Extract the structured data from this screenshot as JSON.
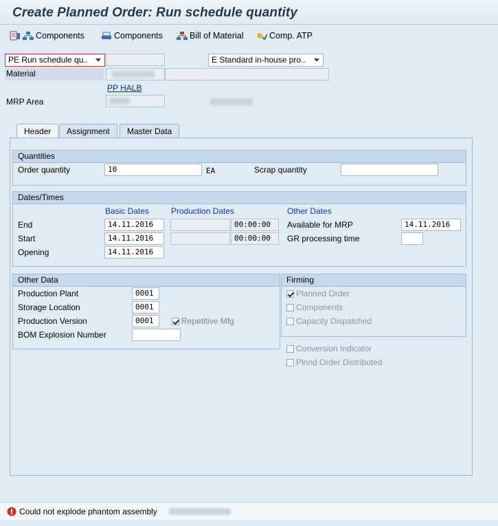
{
  "title": "Create Planned Order: Run schedule quantity",
  "toolbar": {
    "components1": "Components",
    "components2": "Components",
    "bom": "Bill of Material",
    "atp": "Comp. ATP"
  },
  "header_fields": {
    "order_type": "PE Run schedule qu..",
    "procurement": "E Standard in-house pro..",
    "material_label": "Material",
    "pp_halb": "PP HALB",
    "mrp_area_label": "MRP Area"
  },
  "tabs": [
    "Header",
    "Assignment",
    "Master Data"
  ],
  "quantities": {
    "heading": "Quantities",
    "order_qty_label": "Order quantity",
    "order_qty": "10",
    "unit": "EA",
    "scrap_label": "Scrap quantity",
    "scrap_value": ""
  },
  "dates": {
    "heading": "Dates/Times",
    "basic_heading": "Basic Dates",
    "production_heading": "Production Dates",
    "other_heading": "Other Dates",
    "end_label": "End",
    "start_label": "Start",
    "opening_label": "Opening",
    "end_basic": "14.11.2016",
    "start_basic": "14.11.2016",
    "opening_basic": "14.11.2016",
    "end_time": "00:00:00",
    "start_time": "00:00:00",
    "available_label": "Available for MRP",
    "available_value": "14.11.2016",
    "gr_label": "GR processing time",
    "gr_value": ""
  },
  "other_data": {
    "heading": "Other Data",
    "plant_label": "Production Plant",
    "plant": "0001",
    "storage_label": "Storage Location",
    "storage": "0001",
    "version_label": "Production Version",
    "version": "0001",
    "repetitive_label": "Repetitive Mfg",
    "bom_expl_label": "BOM Explosion Number",
    "bom_expl": ""
  },
  "firming": {
    "heading": "Firming",
    "planned_order": "Planned Order",
    "components": "Components",
    "capacity": "Capacity Dispatched",
    "conversion": "Conversion Indicator",
    "distributed": "Plnnd Order Distributed"
  },
  "status": {
    "message": "Could not explode phantom assembly"
  }
}
